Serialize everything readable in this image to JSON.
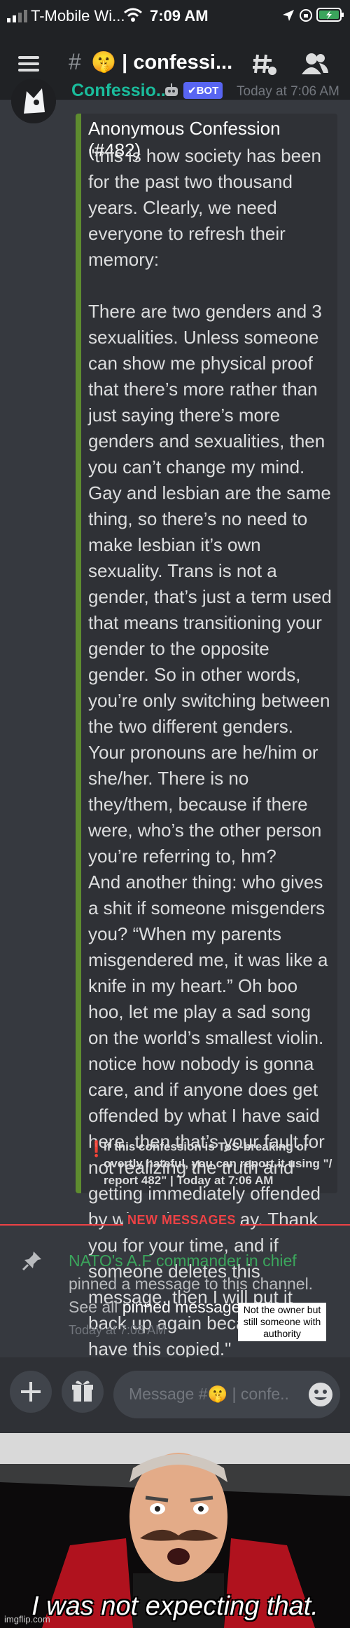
{
  "status_bar": {
    "carrier": "T-Mobile Wi...",
    "time": "7:09 AM"
  },
  "channel": {
    "title": "🤫 | confessi..."
  },
  "message": {
    "author": "Confessio...",
    "bot_badge": "✔BOT",
    "timestamp": "Today at 7:06 AM",
    "embed_title": "Anonymous Confession (#482)",
    "embed_body": "\"this is how society has been for the past two thousand years. Clearly, we need everyone to refresh their memory:\n\nThere are two genders and 3 sexualities. Unless someone can show me physical proof that there’s more rather than just saying there’s more genders and sexualities, then you can’t change my mind. Gay and lesbian are the same thing, so there’s no need to make lesbian it’s own sexuality. Trans is not a gender, that’s just a term used that means transitioning your gender to the opposite gender. So in other words, you’re only switching between the two different genders.\nYour pronouns are he/him or she/her. There is no they/them, because if there were, who’s the other person you’re referring to, hm?\nAnd another thing: who gives a shit if someone misgenders you? “When my parents misgendered me, it was like a knife in my heart.” Oh boo hoo, let me play a sad song on the world’s smallest violin. notice how nobody is gonna care, and if anyone does get offended by what I have said here, then that’s your fault for not realizing the truth and getting immediately offended by what I have to say. Thank you for your time, and if someone deletes this message, then I will put it back up again because I do have this copied.\"",
    "footer": "If this confession is ToS-breaking or overtly hateful, you can report it using \"/ report 482\" | Today at 7:06 AM"
  },
  "new_messages_label": "NEW MESSAGES",
  "system_message": {
    "user": "NATO's A.F commander in chief",
    "text1": "pinned a message to this channel.",
    "text2": "See all",
    "link": "pinned messages",
    "timestamp": "Today at 7:08 AM"
  },
  "annotation": "Not the owner but still someone with authority",
  "composer": {
    "placeholder": "Message #🤫 | confe.."
  },
  "meme": {
    "caption": "I was not expecting that.",
    "watermark": "imgflip.com"
  },
  "colors": {
    "background": "#36393f",
    "embed_bar": "#5e8c2f",
    "bot_badge": "#5865f2",
    "pinner": "#3ba55c",
    "link": "#00b0f4",
    "new_messages": "#ed4245"
  }
}
